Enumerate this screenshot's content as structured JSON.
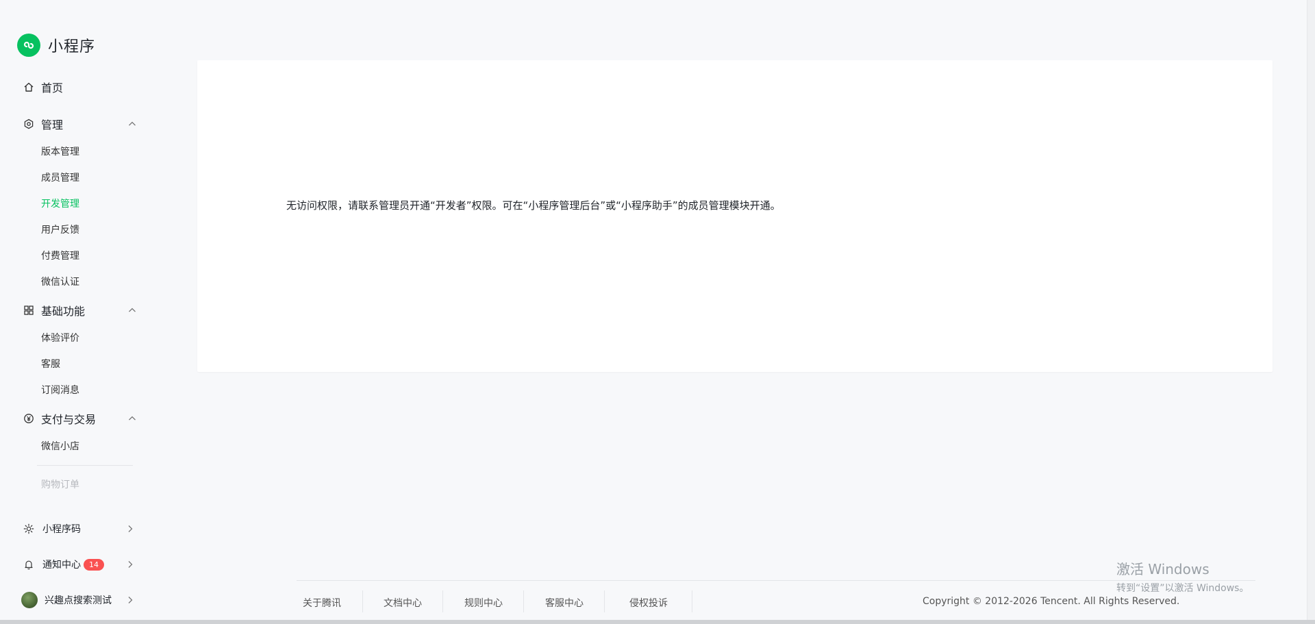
{
  "app": {
    "title": "小程序",
    "accent": "#07c160",
    "badge_color": "#fa5151"
  },
  "sidebar": {
    "home": {
      "label": "首页",
      "icon": "home-icon"
    },
    "groups": [
      {
        "label": "管理",
        "icon": "hexagon-gear-icon",
        "items": [
          "版本管理",
          "成员管理",
          "开发管理",
          "用户反馈",
          "付费管理",
          "微信认证"
        ]
      },
      {
        "label": "基础功能",
        "icon": "grid-apps-icon",
        "items": [
          "体验评价",
          "客服",
          "订阅消息"
        ]
      },
      {
        "label": "支付与交易",
        "icon": "yuan-circle-icon",
        "items": [
          "微信小店",
          "购物订单"
        ]
      }
    ],
    "active_item": "开发管理",
    "disabled_item": "购物订单",
    "bottom": [
      {
        "label": "小程序码",
        "icon": "sun-code-icon"
      },
      {
        "label": "通知中心",
        "icon": "bell-icon",
        "badge": "14"
      },
      {
        "label": "兴趣点搜索测试",
        "icon": "avatar"
      }
    ]
  },
  "main": {
    "message": "无访问权限，请联系管理员开通“开发者”权限。可在“小程序管理后台”或“小程序助手”的成员管理模块开通。"
  },
  "footer": {
    "links": [
      "关于腾讯",
      "文档中心",
      "规则中心",
      "客服中心",
      "侵权投诉"
    ],
    "copyright": "Copyright © 2012-2026 Tencent. All Rights Reserved."
  },
  "watermark": {
    "line1": "激活 Windows",
    "line2": "转到“设置”以激活 Windows。"
  }
}
